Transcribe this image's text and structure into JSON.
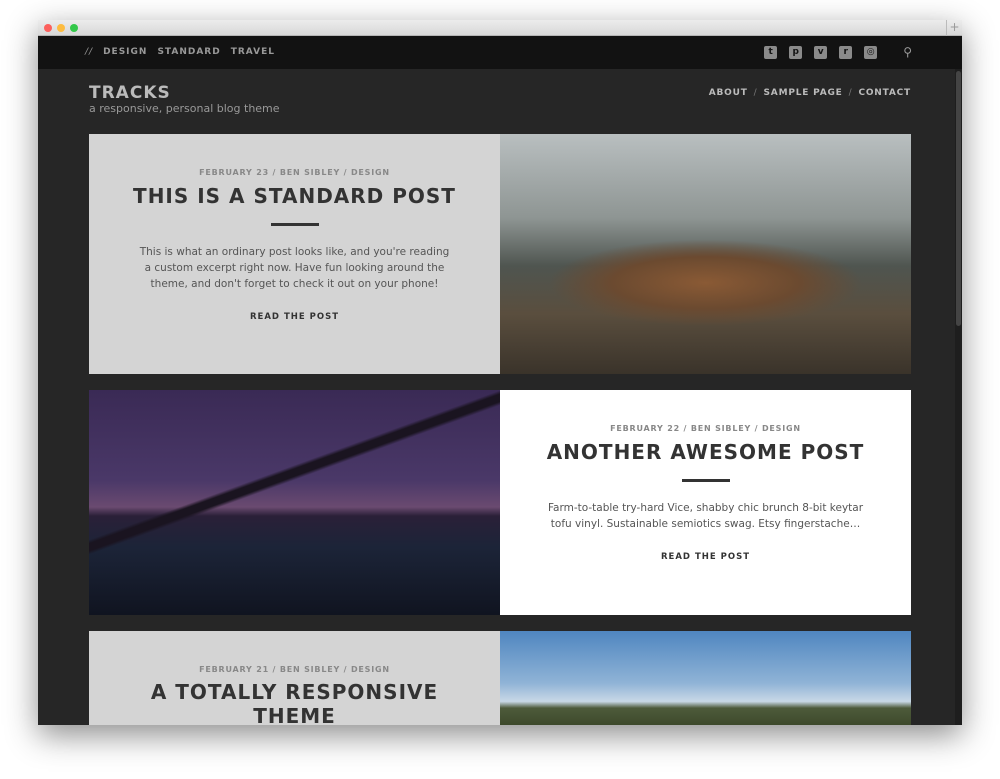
{
  "window": {
    "colors": {
      "close": "#fc605c",
      "minimize": "#fdbc40",
      "maximize": "#34c84a"
    },
    "new_tab_label": "+"
  },
  "topbar": {
    "nav": [
      "//",
      "DESIGN",
      "STANDARD",
      "TRAVEL"
    ],
    "social_icons": [
      "twitter-icon",
      "pinterest-icon",
      "vimeo-icon",
      "rss-icon",
      "instagram-icon"
    ],
    "social_glyphs": [
      "t",
      "p",
      "v",
      "r",
      "◎"
    ],
    "search_glyph": "⚲"
  },
  "header": {
    "title": "TRACKS",
    "tagline": "a responsive, personal blog theme",
    "menu": [
      "ABOUT",
      "SAMPLE PAGE",
      "CONTACT"
    ],
    "separator": "/"
  },
  "posts": [
    {
      "meta": "FEBRUARY 23 / BEN SIBLEY / DESIGN",
      "title": "THIS IS A STANDARD POST",
      "excerpt": "This is what an ordinary post looks like, and you're reading a custom excerpt right now. Have fun looking around the theme, and don't forget to check it out on your phone!",
      "more": "READ THE POST"
    },
    {
      "meta": "FEBRUARY 22 / BEN SIBLEY / DESIGN",
      "title": "ANOTHER AWESOME POST",
      "excerpt": "Farm-to-table try-hard Vice, shabby chic brunch 8-bit keytar tofu vinyl. Sustainable semiotics swag. Etsy fingerstache…",
      "more": "READ THE POST"
    },
    {
      "meta": "FEBRUARY 21 / BEN SIBLEY / DESIGN",
      "title": "A TOTALLY RESPONSIVE THEME"
    }
  ]
}
